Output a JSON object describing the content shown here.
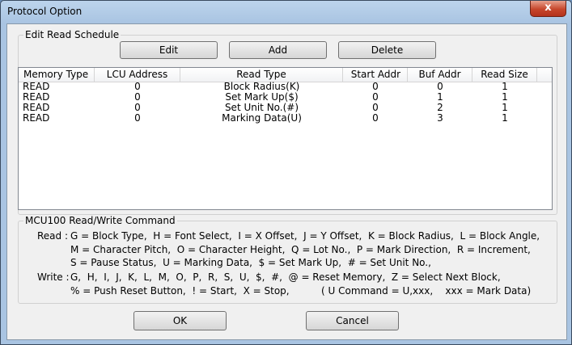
{
  "window": {
    "title": "Protocol Option",
    "close_label": "x"
  },
  "edit_group": {
    "legend": "Edit Read Schedule",
    "buttons": {
      "edit": "Edit",
      "add": "Add",
      "delete": "Delete"
    }
  },
  "table": {
    "columns": [
      "Memory Type",
      "LCU Address",
      "Read Type",
      "Start Addr",
      "Buf Addr",
      "Read Size"
    ],
    "rows": [
      [
        "READ",
        "0",
        "Block Radius(K)",
        "0",
        "0",
        "1"
      ],
      [
        "READ",
        "0",
        "Set Mark Up($)",
        "0",
        "1",
        "1"
      ],
      [
        "READ",
        "0",
        "Set Unit No.(#)",
        "0",
        "2",
        "1"
      ],
      [
        "READ",
        "0",
        "Marking Data(U)",
        "0",
        "3",
        "1"
      ]
    ]
  },
  "command_group": {
    "legend": "MCU100 Read/Write Command",
    "read_label": "Read :",
    "read_lines": [
      "G = Block Type,  H = Font Select,  I = X Offset,  J = Y Offset,  K = Block Radius,  L = Block Angle,",
      "M = Character Pitch,  O = Character Height,  Q = Lot No.,  P = Mark Direction,  R = Increment,",
      "S = Pause Status,  U = Marking Data,  $ = Set Mark Up,  # = Set Unit No.,"
    ],
    "write_label": "Write :",
    "write_lines": [
      "G,  H,  I,  J,  K,  L,  M,  O,  P,  R,  S,  U,  $,  #,  @ = Reset Memory,  Z = Select Next Block,",
      "% = Push Reset Button,  ! = Start,  X = Stop,"
    ],
    "write_note": "( U Command = U,xxx,    xxx = Mark Data)"
  },
  "footer": {
    "ok_label": "OK",
    "cancel_label": "Cancel"
  }
}
